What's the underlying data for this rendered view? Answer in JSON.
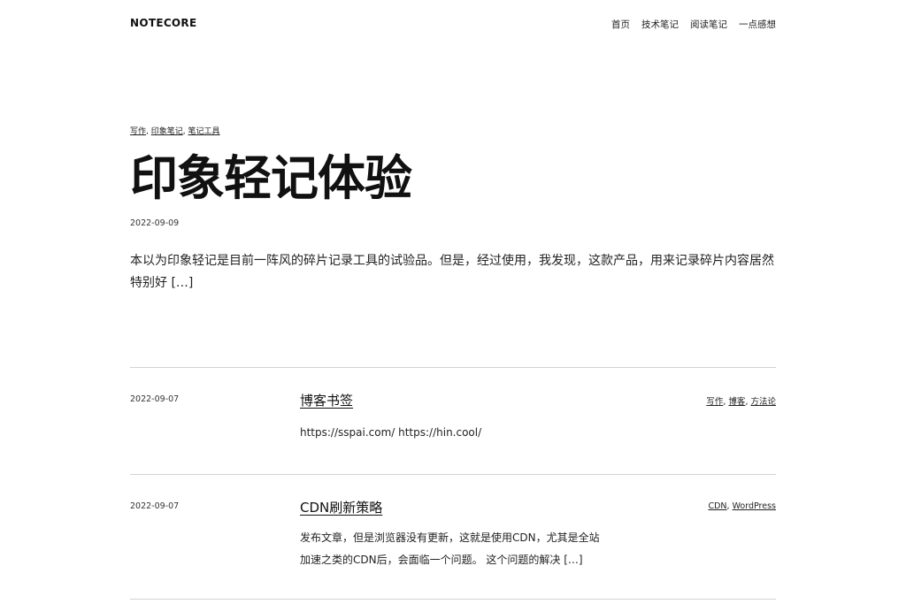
{
  "site": {
    "title": "NOTECORE"
  },
  "nav": {
    "items": [
      "首页",
      "技术笔记",
      "阅读笔记",
      "一点感想"
    ]
  },
  "featured": {
    "categories": [
      "写作",
      "印象笔记",
      "笔记工具"
    ],
    "title": "印象轻记体验",
    "date": "2022-09-09",
    "excerpt": "本以为印象轻记是目前一阵风的碎片记录工具的试验品。但是，经过使用，我发现，这款产品，用来记录碎片内容居然特别好 […]"
  },
  "posts": [
    {
      "date": "2022-09-07",
      "title": "博客书签",
      "categories": [
        "写作",
        "博客",
        "方法论"
      ],
      "excerpt": "https://sspai.com/ https://hin.cool/"
    },
    {
      "date": "2022-09-07",
      "title": "CDN刷新策略",
      "categories": [
        "CDN",
        "WordPress"
      ],
      "excerpt": "发布文章，但是浏览器没有更新，这就是使用CDN，尤其是全站加速之类的CDN后，会面临一个问题。 这个问题的解决 […]"
    }
  ]
}
